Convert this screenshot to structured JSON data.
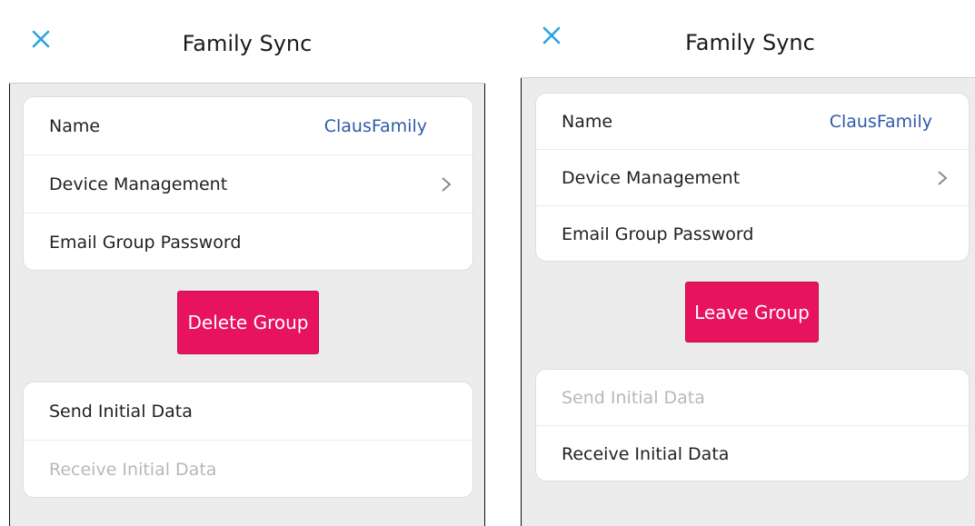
{
  "screens": [
    {
      "title": "Family Sync",
      "settings": [
        {
          "label": "Name",
          "value": "ClausFamily"
        },
        {
          "label": "Device Management"
        },
        {
          "label": "Email Group Password"
        }
      ],
      "action_button": "Delete Group",
      "sync": {
        "send_label": "Send Initial Data",
        "receive_label": "Receive Initial Data",
        "enabled": "send"
      }
    },
    {
      "title": "Family Sync",
      "settings": [
        {
          "label": "Name",
          "value": "ClausFamily"
        },
        {
          "label": "Device Management"
        },
        {
          "label": "Email Group Password"
        }
      ],
      "action_button": "Leave Group",
      "sync": {
        "send_label": "Send Initial Data",
        "receive_label": "Receive Initial Data",
        "enabled": "receive"
      }
    }
  ],
  "colors": {
    "accent_close": "#2aa3df",
    "action_button": "#e8135f",
    "value_text": "#2f5aa8",
    "disabled_text": "#b8b8b8",
    "background": "#ececec"
  },
  "icons": {
    "close": "close-icon",
    "chevron": "chevron-right-icon"
  }
}
